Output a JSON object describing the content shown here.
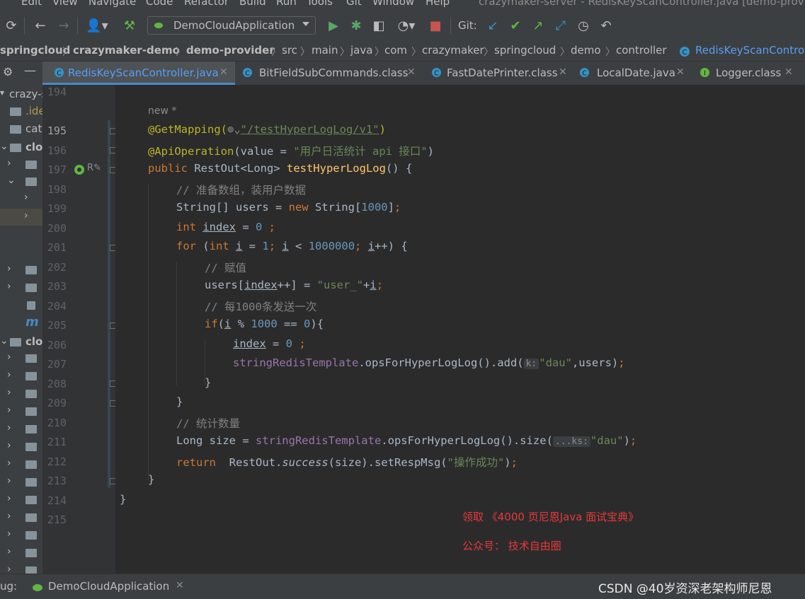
{
  "menu": {
    "items": [
      "Edit",
      "View",
      "Navigate",
      "Code",
      "Refactor",
      "Build",
      "Run",
      "Tools",
      "Git",
      "Window",
      "Help"
    ],
    "window_title": "crazymaker-server - RedisKeyScanController.java [demo-provid"
  },
  "toolbar": {
    "run_config": "DemoCloudApplication",
    "git_label": "Git:"
  },
  "breadcrumb": [
    "springcloud",
    "crazymaker-demo",
    "demo-provider",
    "src",
    "main",
    "java",
    "com",
    "crazymaker",
    "springcloud",
    "demo",
    "controller",
    "RedisKeyScanControl"
  ],
  "tabs": [
    {
      "label": "RedisKeyScanController.java",
      "icon": "class-icon",
      "active": true
    },
    {
      "label": "BitFieldSubCommands.class",
      "icon": "class-icon",
      "active": false
    },
    {
      "label": "FastDatePrinter.class",
      "icon": "class-icon",
      "active": false
    },
    {
      "label": "LocalDate.java",
      "icon": "class-icon",
      "active": false
    },
    {
      "label": "Logger.class",
      "icon": "interface-icon",
      "active": false
    }
  ],
  "project_tree": {
    "items": [
      "crazy-s",
      ".ide",
      "cat",
      "clo",
      "clo"
    ]
  },
  "editor": {
    "inlay_new": "new *",
    "line_numbers": [
      "194",
      "195",
      "196",
      "197",
      "198",
      "199",
      "200",
      "201",
      "202",
      "203",
      "204",
      "205",
      "206",
      "207",
      "208",
      "209",
      "210",
      "211",
      "212",
      "213",
      "214",
      "215"
    ],
    "code": {
      "l195_ann": "@GetMapping(",
      "l195_str": "\"/testHyperLogLog/v1\"",
      "l195_close": ")",
      "l196_ann": "@ApiOperation",
      "l196_a": "(value = ",
      "l196_str": "\"用户日活统计 api 接口\"",
      "l196_b": ")",
      "l197_kw": "public ",
      "l197_type": "RestOut<Long> ",
      "l197_mth": "testHyperLogLog",
      "l197_end": "() {",
      "l198": "// 准备数组，装用户数据",
      "l199_a": "String[] users = ",
      "l199_kw": "new ",
      "l199_b": "String[",
      "l199_num": "1000",
      "l199_c": "]",
      "l199_semi": ";",
      "l200_kw": "int ",
      "l200_var": "index",
      "l200_a": " = ",
      "l200_num": "0",
      "l200_semi": " ;",
      "l201_kw1": "for ",
      "l201_a": "(",
      "l201_kw2": "int ",
      "l201_v1": "i",
      "l201_b": " = ",
      "l201_n1": "1",
      "l201_s1": "; ",
      "l201_v2": "i",
      "l201_c": " < ",
      "l201_n2": "1000000",
      "l201_s2": "; ",
      "l201_v3": "i",
      "l201_d": "++) {",
      "l202": "// 赋值",
      "l203_a": "users[",
      "l203_var": "index",
      "l203_b": "++] = ",
      "l203_str": "\"user_\"",
      "l203_c": "+",
      "l203_v": "i",
      "l203_semi": ";",
      "l204": "// 每1000条发送一次",
      "l205_kw": "if",
      "l205_a": "(",
      "l205_v": "i",
      "l205_b": " % ",
      "l205_n1": "1000",
      "l205_c": " == ",
      "l205_n2": "0",
      "l205_d": "){",
      "l206_var": "index",
      "l206_a": " = ",
      "l206_num": "0",
      "l206_semi": " ;",
      "l207_fld": "stringRedisTemplate",
      "l207_a": ".opsForHyperLogLog().add(",
      "l207_hint": "k:",
      "l207_str": "\"dau\"",
      "l207_b": ",users)",
      "l207_semi": ";",
      "l208": "}",
      "l209": "}",
      "l210": "// 统计数量",
      "l211_a": "Long size = ",
      "l211_fld": "stringRedisTemplate",
      "l211_b": ".opsForHyperLogLog().size(",
      "l211_hint": "...ks:",
      "l211_str": "\"dau\"",
      "l211_c": ")",
      "l211_semi": ";",
      "l212_kw": "return  ",
      "l212_a": "RestOut.",
      "l212_it": "success",
      "l212_b": "(size).setRespMsg(",
      "l212_str": "\"操作成功\"",
      "l212_c": ")",
      "l212_semi": ";",
      "l213": "}",
      "l214": "}"
    }
  },
  "overlay": {
    "line1": "领取 《4000 页尼恩Java 面试宝典》",
    "line2": "公众号： 技术自由圈"
  },
  "status": {
    "debug_label": "ug:",
    "debug_tab": "DemoCloudApplication",
    "watermark": "CSDN @40岁资深老架构师尼恩"
  },
  "colors": {
    "background": "#2b2b2b",
    "keyword": "#cc7832",
    "annotation": "#bbb529",
    "string": "#6a8759",
    "number": "#6897bb",
    "comment": "#808080",
    "field": "#9876aa",
    "method": "#ffc66d",
    "accent": "#4a88c7",
    "overlay_red": "#e8383d"
  }
}
